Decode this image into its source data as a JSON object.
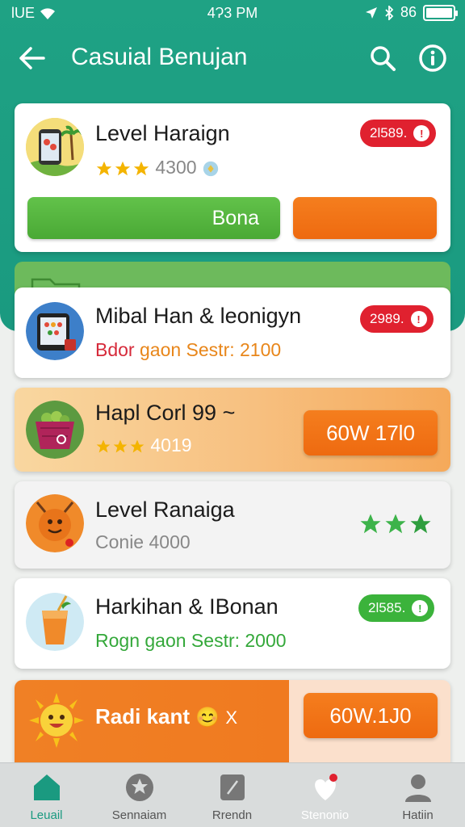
{
  "status_bar": {
    "carrier": "lUE",
    "time": "4Ɂ3 PM",
    "right_text": "86"
  },
  "app_bar": {
    "title": "Casuial Benujan",
    "back_icon": "back-arrow-icon",
    "search_icon": "search-icon",
    "info_icon": "info-icon"
  },
  "top_card": {
    "title": "Level Haraign",
    "rating_value": "4300",
    "stars": 3,
    "badge_text": "2l589.",
    "badge_color": "#e0212f",
    "primary_button": "Bona",
    "primary_color": "#55b73f",
    "secondary_button": "",
    "secondary_color": "#f26b10"
  },
  "cards": [
    {
      "title": "Mibal Han & leonigyn",
      "subtitle_prefix": "Bdor",
      "subtitle_rest": "gaon Sestr: 2100",
      "badge_text": "2989.",
      "badge_color": "#e0212f"
    },
    {
      "title": "Hapl Corl 99 ~",
      "rating_value": "4019",
      "stars": 3,
      "button_label": "60W 17l0"
    },
    {
      "title": "Level Ranaiga",
      "subtitle": "Conie 4000",
      "stars": 3
    },
    {
      "title": "Harkihan & IBonan",
      "subtitle_prefix": "Rogn",
      "subtitle_rest": "gaon Sestr: 2000",
      "badge_text": "2l585.",
      "badge_color": "#3bb33b"
    },
    {
      "title": "Radi kant",
      "emoji": "😊",
      "suffix": "X",
      "button_label": "60W.1J0"
    }
  ],
  "bottom_nav": [
    {
      "label": "Leuail",
      "icon": "home-icon",
      "active": true
    },
    {
      "label": "Sennaiam",
      "icon": "star-badge-icon",
      "active": false
    },
    {
      "label": "Rrendn",
      "icon": "edit-icon",
      "active": false
    },
    {
      "label": "Stenonio",
      "icon": "heart-notification-icon",
      "active": false
    },
    {
      "label": "Hatiin",
      "icon": "person-icon",
      "active": false
    }
  ]
}
